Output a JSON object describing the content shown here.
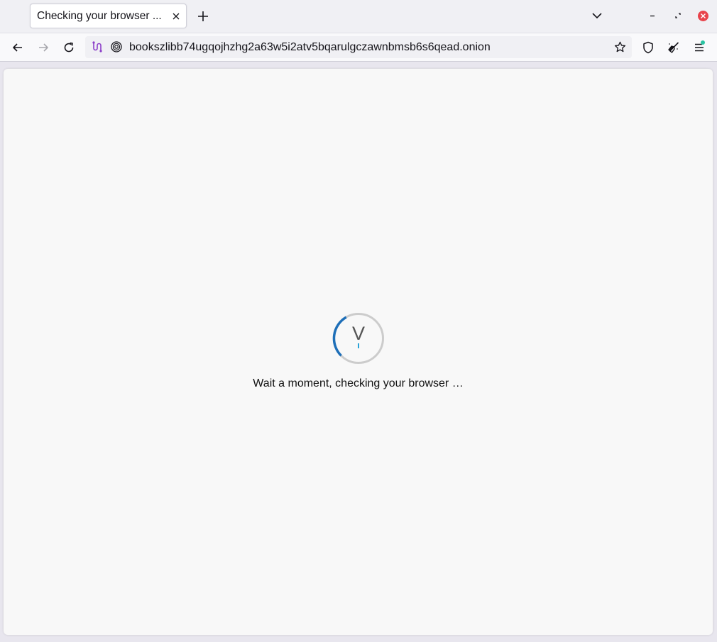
{
  "tabs": [
    {
      "title": "Checking your browser ...",
      "active": true
    }
  ],
  "urlbar": {
    "url": "bookszlibb74ugqojhzhg2a63w5i2atv5bqarulgczawnbmsb6s6qead.onion"
  },
  "page": {
    "spinner_letter": "V",
    "message": "Wait a moment, checking your browser …"
  },
  "colors": {
    "spinner_track": "#cccccc",
    "spinner_arc": "#1e6fb8",
    "window_close": "#e8434b",
    "menu_badge": "#2ac3a2"
  },
  "icons": {
    "tab_close": "close-icon",
    "new_tab": "plus-icon",
    "tab_list": "chevron-down-icon",
    "back": "arrow-left-icon",
    "forward": "arrow-right-icon",
    "reload": "reload-icon",
    "circuit": "tor-circuit-icon",
    "onion": "onion-icon",
    "bookmark": "star-icon",
    "security": "shield-icon",
    "new_identity": "broom-icon",
    "menu": "hamburger-menu-icon"
  }
}
